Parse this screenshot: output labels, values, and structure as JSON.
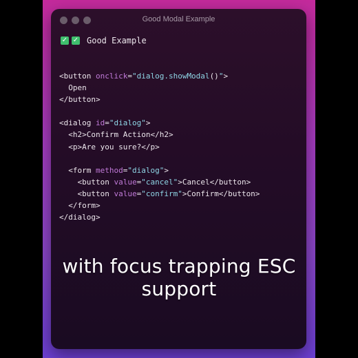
{
  "window": {
    "title": "Good Modal Example"
  },
  "heading": {
    "text": "Good Example",
    "icons": [
      "check-icon",
      "check-icon"
    ]
  },
  "code": {
    "lines": [
      [
        {
          "t": "tag",
          "v": "<button "
        },
        {
          "t": "attr",
          "v": "onclick"
        },
        {
          "t": "tag",
          "v": "="
        },
        {
          "t": "str",
          "v": "\"dialog.showModal"
        },
        {
          "t": "tag",
          "v": "()"
        },
        {
          "t": "str",
          "v": "\""
        },
        {
          "t": "tag",
          "v": ">"
        }
      ],
      [
        {
          "t": "txt",
          "v": "  Open"
        }
      ],
      [
        {
          "t": "tag",
          "v": "</button>"
        }
      ],
      [],
      [
        {
          "t": "tag",
          "v": "<dialog "
        },
        {
          "t": "attr",
          "v": "id"
        },
        {
          "t": "tag",
          "v": "="
        },
        {
          "t": "str",
          "v": "\"dialog\""
        },
        {
          "t": "tag",
          "v": ">"
        }
      ],
      [
        {
          "t": "tag",
          "v": "  <h2>"
        },
        {
          "t": "txt",
          "v": "Confirm Action"
        },
        {
          "t": "tag",
          "v": "</h2>"
        }
      ],
      [
        {
          "t": "tag",
          "v": "  <p>"
        },
        {
          "t": "txt",
          "v": "Are you sure?"
        },
        {
          "t": "tag",
          "v": "</p>"
        }
      ],
      [],
      [
        {
          "t": "tag",
          "v": "  <form "
        },
        {
          "t": "attr",
          "v": "method"
        },
        {
          "t": "tag",
          "v": "="
        },
        {
          "t": "str",
          "v": "\"dialog\""
        },
        {
          "t": "tag",
          "v": ">"
        }
      ],
      [
        {
          "t": "tag",
          "v": "    <button "
        },
        {
          "t": "attr",
          "v": "value"
        },
        {
          "t": "tag",
          "v": "="
        },
        {
          "t": "str",
          "v": "\"cancel\""
        },
        {
          "t": "tag",
          "v": ">"
        },
        {
          "t": "txt",
          "v": "Cancel"
        },
        {
          "t": "tag",
          "v": "</button>"
        }
      ],
      [
        {
          "t": "tag",
          "v": "    <button "
        },
        {
          "t": "attr",
          "v": "value"
        },
        {
          "t": "tag",
          "v": "="
        },
        {
          "t": "str",
          "v": "\"confirm\""
        },
        {
          "t": "tag",
          "v": ">"
        },
        {
          "t": "txt",
          "v": "Confirm"
        },
        {
          "t": "tag",
          "v": "</button>"
        }
      ],
      [
        {
          "t": "tag",
          "v": "  </form>"
        }
      ],
      [
        {
          "t": "tag",
          "v": "</dialog>"
        }
      ]
    ]
  },
  "caption": {
    "line1": "with focus trapping ESC",
    "line2": "support"
  },
  "colors": {
    "check": "#3fbf6e",
    "attribute": "#c07ad8",
    "string": "#8fd6e6",
    "tag": "#ece6ec"
  }
}
